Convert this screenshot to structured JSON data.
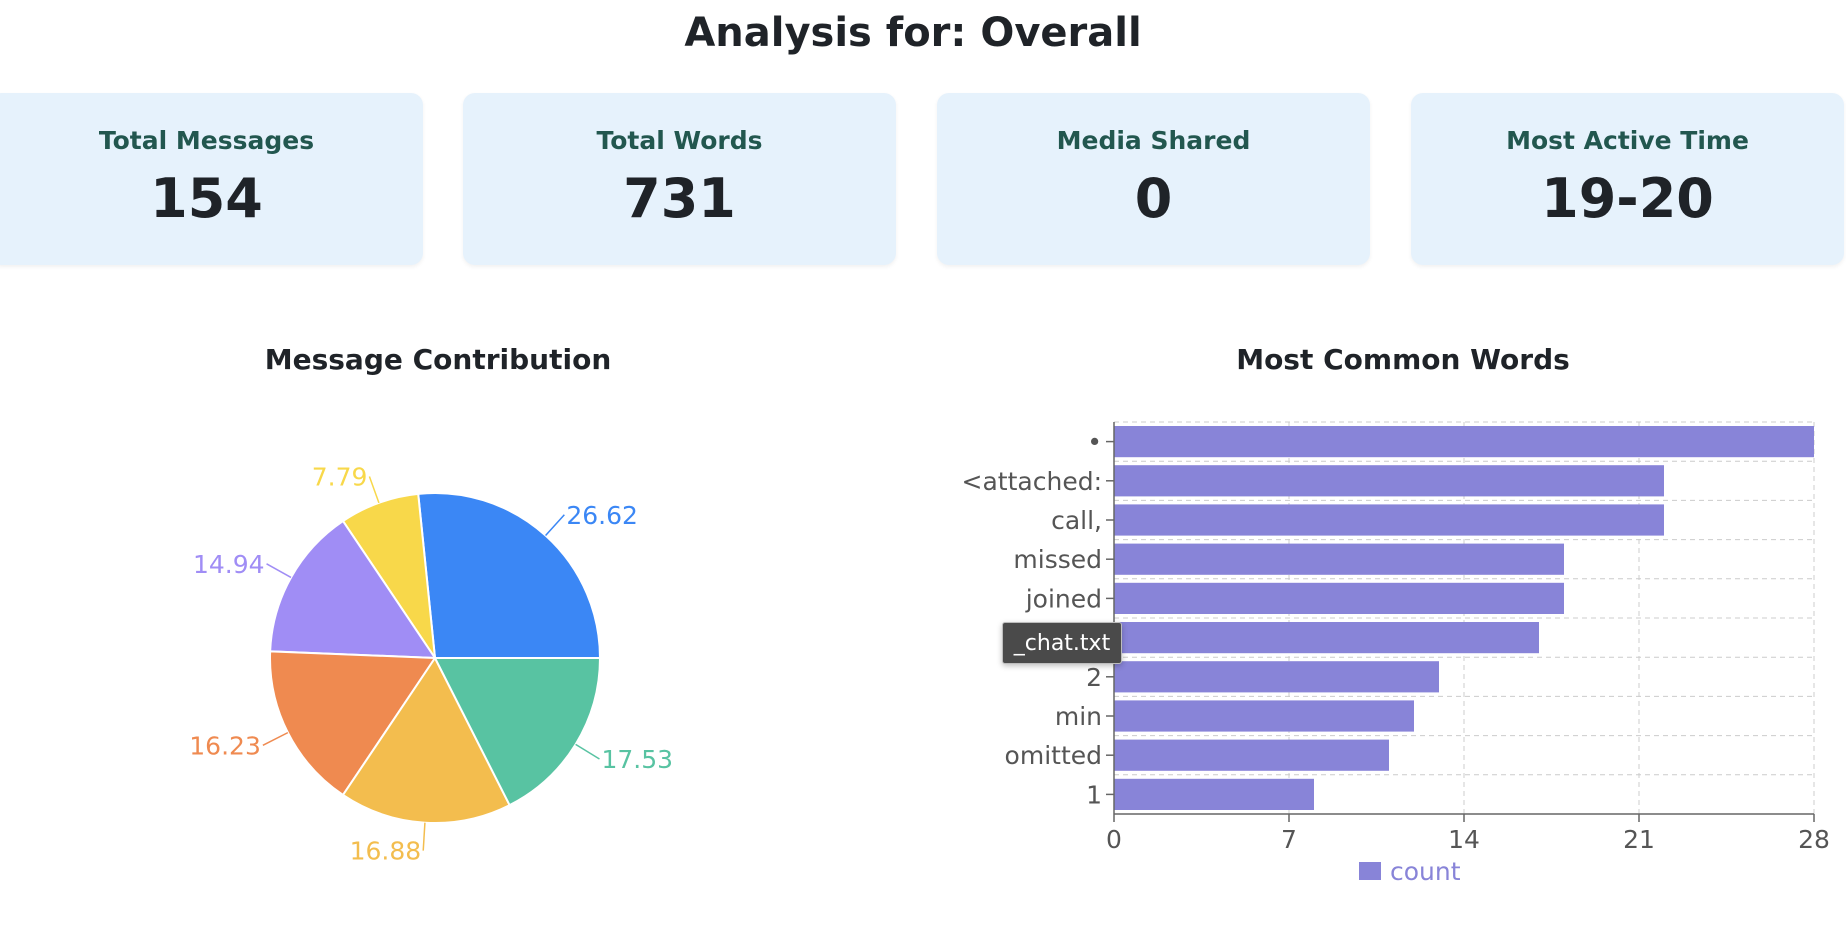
{
  "header": {
    "title": "Analysis for: Overall"
  },
  "stats": [
    {
      "label": "Total Messages",
      "value": "154"
    },
    {
      "label": "Total Words",
      "value": "731"
    },
    {
      "label": "Media Shared",
      "value": "0"
    },
    {
      "label": "Most Active Time",
      "value": "19-20"
    }
  ],
  "pie_chart": {
    "title": "Message Contribution"
  },
  "bar_chart": {
    "title": "Most Common Words"
  },
  "tooltip": {
    "text": "_chat.txt"
  },
  "chart_data": [
    {
      "type": "pie",
      "title": "Message Contribution",
      "slices": [
        {
          "value": 26.62,
          "color": "#3b87f5"
        },
        {
          "value": 7.79,
          "color": "#f8d84a"
        },
        {
          "value": 14.94,
          "color": "#a08df5"
        },
        {
          "value": 16.23,
          "color": "#ef8a50"
        },
        {
          "value": 16.88,
          "color": "#f3bd4e"
        },
        {
          "value": 17.53,
          "color": "#58c3a2"
        }
      ]
    },
    {
      "type": "bar",
      "orientation": "horizontal",
      "title": "Most Common Words",
      "categories": [
        "•",
        "<attached:",
        "call,",
        "missed",
        "joined",
        "",
        "2",
        "min",
        "omitted",
        "1"
      ],
      "series": [
        {
          "name": "count",
          "values": [
            28,
            22,
            22,
            18,
            18,
            17,
            13,
            12,
            11,
            8
          ],
          "color": "#8884d8"
        }
      ],
      "xlim": [
        0,
        28
      ],
      "xticks": [
        0,
        7,
        14,
        21,
        28
      ],
      "grid": true,
      "legend": "bottom"
    }
  ]
}
